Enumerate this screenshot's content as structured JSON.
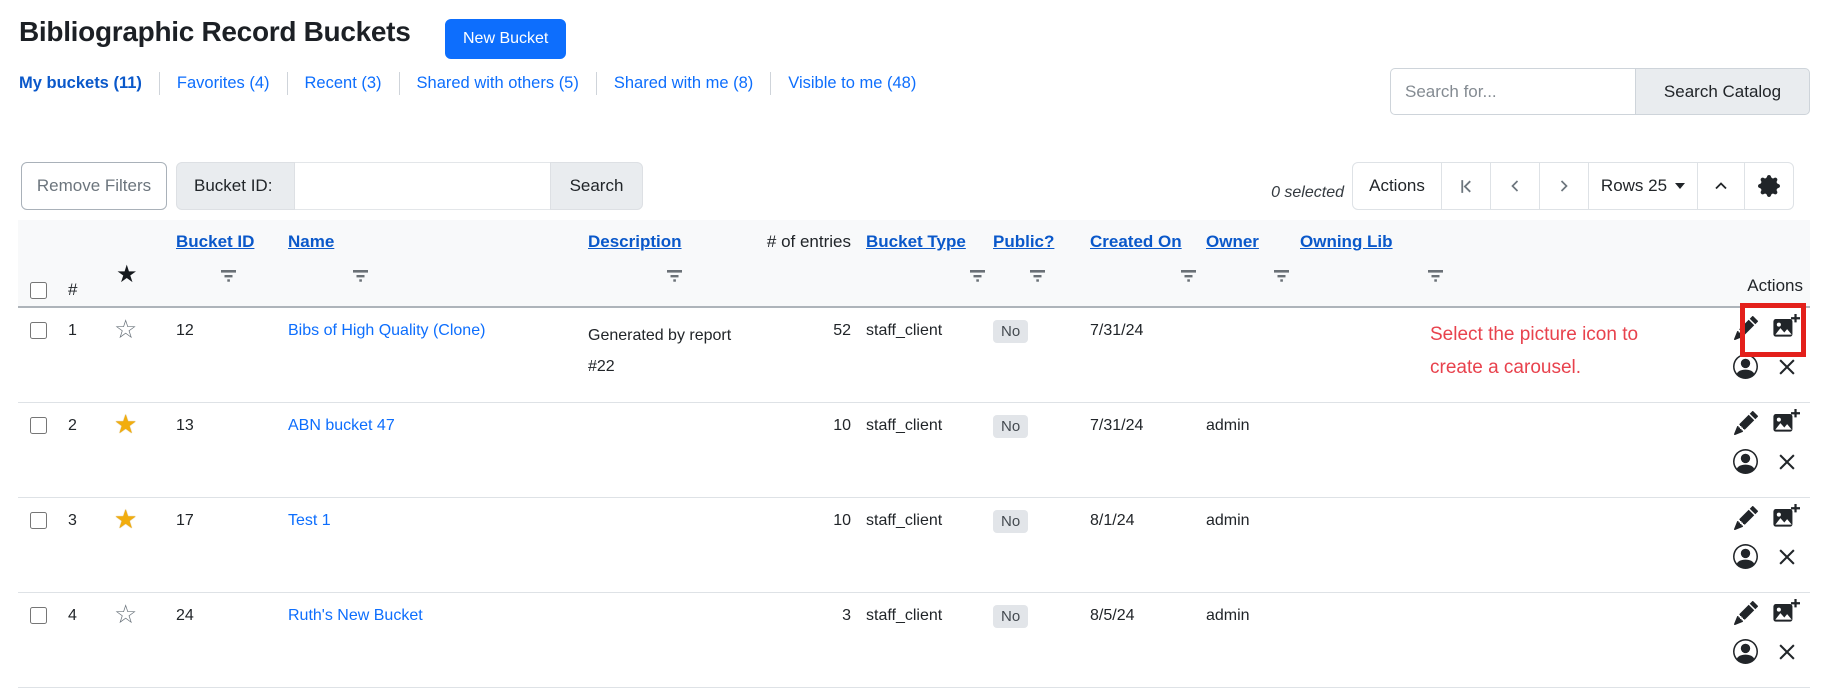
{
  "page": {
    "title": "Bibliographic Record Buckets"
  },
  "buttons": {
    "new_bucket": "New Bucket",
    "search_catalog": "Search Catalog",
    "remove_filters": "Remove Filters",
    "filter_search": "Search",
    "actions": "Actions",
    "rows_per_page": "Rows 25"
  },
  "tabs": [
    {
      "label": "My buckets (11)",
      "active": true
    },
    {
      "label": "Favorites (4)",
      "active": false
    },
    {
      "label": "Recent (3)",
      "active": false
    },
    {
      "label": "Shared with others (5)",
      "active": false
    },
    {
      "label": "Shared with me (8)",
      "active": false
    },
    {
      "label": "Visible to me (48)",
      "active": false
    }
  ],
  "catalog_search": {
    "placeholder": "Search for...",
    "value": ""
  },
  "filter_bar": {
    "bucket_id_label": "Bucket ID:",
    "bucket_id_value": ""
  },
  "status": {
    "selected": "0 selected"
  },
  "table": {
    "headers": {
      "num": "#",
      "bucket_id": "Bucket ID",
      "name": "Name",
      "description": "Description",
      "entries": "# of entries",
      "bucket_type": "Bucket Type",
      "public": "Public?",
      "created_on": "Created On",
      "owner": "Owner",
      "owning_lib": "Owning Lib",
      "actions": "Actions"
    },
    "rows": [
      {
        "num": "1",
        "favorite": false,
        "bucket_id": "12",
        "name": "Bibs of High Quality (Clone)",
        "description": "Generated by report #22",
        "entries": "52",
        "bucket_type": "staff_client",
        "public": "No",
        "created_on": "7/31/24",
        "owner": "",
        "owning_lib": ""
      },
      {
        "num": "2",
        "favorite": true,
        "bucket_id": "13",
        "name": "ABN bucket 47",
        "description": "",
        "entries": "10",
        "bucket_type": "staff_client",
        "public": "No",
        "created_on": "7/31/24",
        "owner": "admin",
        "owning_lib": ""
      },
      {
        "num": "3",
        "favorite": true,
        "bucket_id": "17",
        "name": "Test 1",
        "description": "",
        "entries": "10",
        "bucket_type": "staff_client",
        "public": "No",
        "created_on": "8/1/24",
        "owner": "admin",
        "owning_lib": ""
      },
      {
        "num": "4",
        "favorite": false,
        "bucket_id": "24",
        "name": "Ruth's New Bucket",
        "description": "",
        "entries": "3",
        "bucket_type": "staff_client",
        "public": "No",
        "created_on": "8/5/24",
        "owner": "admin",
        "owning_lib": ""
      }
    ]
  },
  "annotation": {
    "text": "Select the picture icon to create a carousel."
  },
  "icons": {
    "first_page": "first-page-icon (bar + chevron-left)",
    "prev_page": "chevron-left-icon",
    "next_page": "chevron-right-icon",
    "collapse": "chevron-up-icon",
    "settings": "gear-icon",
    "rows_caret": "caret-down-icon",
    "column_filter": "filter-lines-icon",
    "favorite_on": "star-filled-icon",
    "favorite_off": "star-outline-icon",
    "edit": "pencil-icon",
    "create_carousel": "image-plus-icon",
    "share_user": "person-circle-icon",
    "delete": "x-icon"
  },
  "colors": {
    "accent": "#0d6efd",
    "header_link": "#0a58ca",
    "annotation_red": "#e8424d",
    "highlight_box_red": "#e3201b",
    "star_gold": "#f2ad0d",
    "badge_bg": "#e2e5e9"
  }
}
